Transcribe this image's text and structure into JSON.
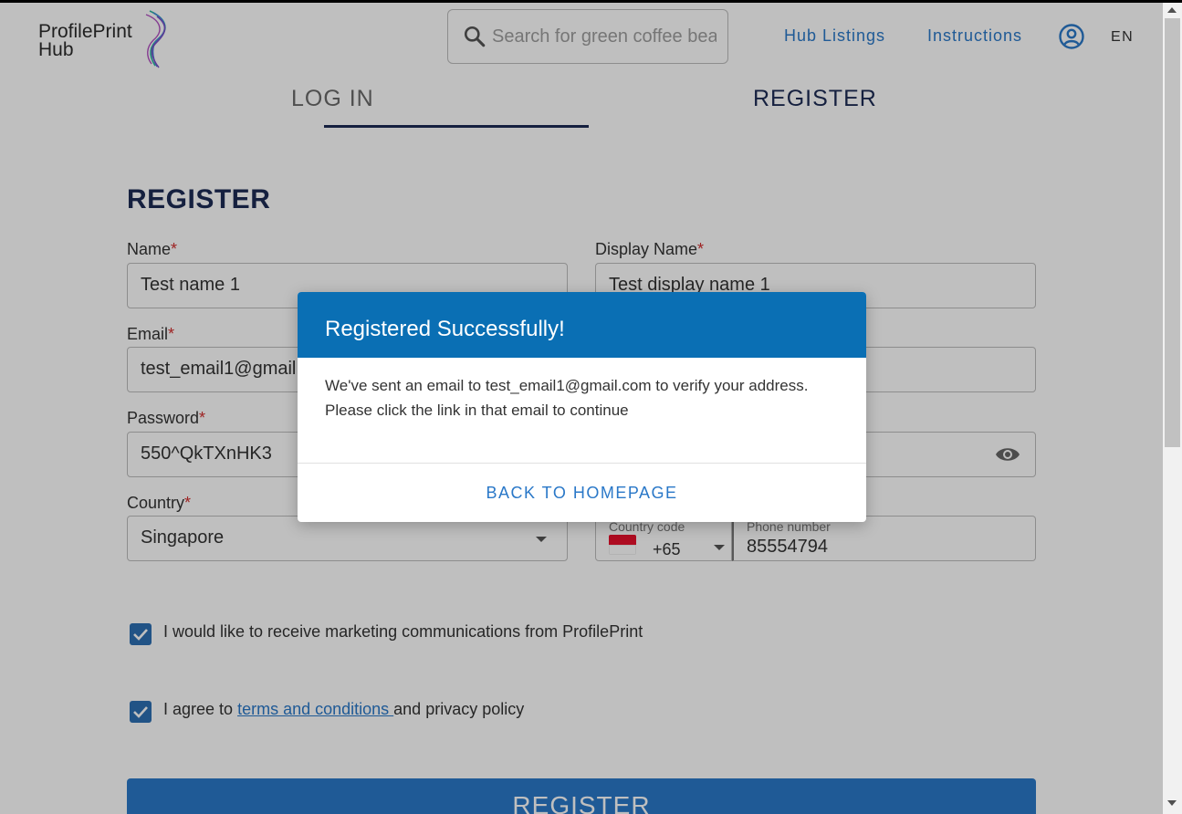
{
  "header": {
    "logo_line1": "ProfilePrint",
    "logo_line2": "Hub",
    "search_placeholder": "Search for green coffee beans",
    "nav_hub_listings": "Hub Listings",
    "nav_instructions": "Instructions",
    "language": "EN"
  },
  "tabs": {
    "login": "LOG IN",
    "register": "REGISTER"
  },
  "form": {
    "title": "REGISTER",
    "required_mark": "*",
    "name_label": "Name",
    "name_value": "Test name 1",
    "display_name_label": "Display Name",
    "display_name_value": "Test display name 1",
    "email_label": "Email",
    "email_value": "test_email1@gmail.com",
    "password_label": "Password",
    "password_value": "550^QkTXnHK3",
    "country_label": "Country",
    "country_value": "Singapore",
    "country_code_label": "Country code",
    "country_code_value": "+65",
    "phone_label": "Phone number",
    "phone_value": "85554794",
    "marketing_text": "I would like to receive marketing communications from ProfilePrint",
    "marketing_checked": true,
    "agree_prefix": "I agree to ",
    "terms_link": "terms and conditions ",
    "agree_suffix": "and privacy policy",
    "agree_checked": true,
    "submit": "REGISTER"
  },
  "modal": {
    "title": "Registered Successfully!",
    "body_line1": "We've sent an email to test_email1@gmail.com to verify your address.",
    "body_line2": "Please click the link in that email to continue",
    "button": "BACK TO HOMEPAGE"
  },
  "icons": {
    "search": "search-icon",
    "user": "user-circle-icon",
    "eye": "eye-icon",
    "checkbox": "checkmark-icon",
    "flag": "singapore-flag-icon",
    "dropdown": "chevron-down-icon"
  },
  "colors": {
    "primary": "#2a78c8",
    "navy": "#1d2b55",
    "modal_header": "#0a6fb4",
    "checkbox": "#2d6fb3",
    "required": "#d32f2f"
  }
}
